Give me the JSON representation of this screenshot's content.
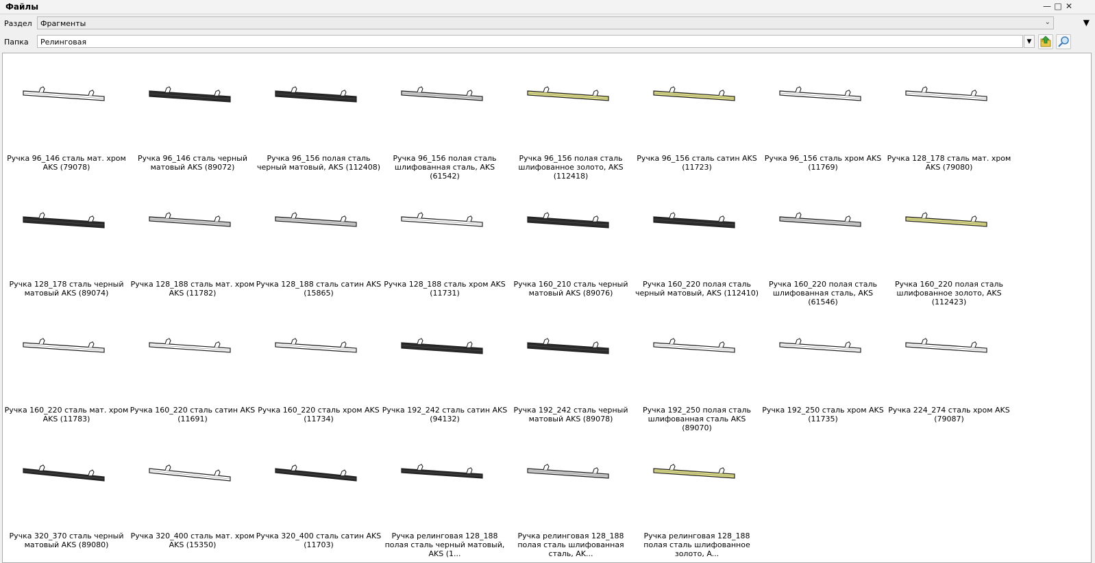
{
  "window": {
    "title": "Файлы",
    "minimize_icon": "minimize-icon",
    "maximize_icon": "maximize-icon",
    "close_icon": "close-icon"
  },
  "section": {
    "label": "Раздел",
    "value": "Фрагменты"
  },
  "folder": {
    "label": "Папка",
    "value": "Релинговая"
  },
  "colors": {
    "black": "#2b2b2b",
    "chrome": "#ffffff",
    "satin": "#d0d0d0",
    "gold": "#dddb82"
  },
  "items": [
    {
      "caption": "Ручка 96_146 сталь мат. хром AKS (79078)",
      "finish": "chrome"
    },
    {
      "caption": "Ручка 96_146 сталь черный матовый AKS (89072)",
      "finish": "black"
    },
    {
      "caption": "Ручка 96_156 полая сталь черный матовый, AKS (112408)",
      "finish": "black"
    },
    {
      "caption": "Ручка 96_156 полая сталь шлифованная сталь, AKS (61542)",
      "finish": "satin"
    },
    {
      "caption": "Ручка 96_156 полая сталь шлифованное золото, AKS (112418)",
      "finish": "gold"
    },
    {
      "caption": "Ручка 96_156 сталь сатин AKS (11723)",
      "finish": "gold"
    },
    {
      "caption": "Ручка 96_156 сталь хром AKS (11769)",
      "finish": "chrome"
    },
    {
      "caption": "Ручка 128_178 сталь мат. хром AKS (79080)",
      "finish": "chrome"
    },
    {
      "caption": "Ручка 128_178 сталь черный матовый AKS (89074)",
      "finish": "black"
    },
    {
      "caption": "Ручка 128_188 сталь мат. хром AKS (11782)",
      "finish": "satin"
    },
    {
      "caption": "Ручка 128_188 сталь сатин AKS (15865)",
      "finish": "satin"
    },
    {
      "caption": "Ручка 128_188 сталь хром AKS (11731)",
      "finish": "chrome"
    },
    {
      "caption": "Ручка 160_210 сталь черный матовый AKS (89076)",
      "finish": "black"
    },
    {
      "caption": "Ручка 160_220 полая сталь черный матовый, AKS (112410)",
      "finish": "black"
    },
    {
      "caption": "Ручка 160_220 полая сталь шлифованная сталь, AKS (61546)",
      "finish": "satin"
    },
    {
      "caption": "Ручка 160_220 полая сталь шлифованное золото, AKS (112423)",
      "finish": "gold"
    },
    {
      "caption": "Ручка 160_220 сталь мат. хром AKS (11783)",
      "finish": "chrome"
    },
    {
      "caption": "Ручка 160_220 сталь сатин AKS (11691)",
      "finish": "chrome"
    },
    {
      "caption": "Ручка 160_220 сталь хром AKS (11734)",
      "finish": "chrome"
    },
    {
      "caption": "Ручка 192_242 сталь сатин AKS (94132)",
      "finish": "black"
    },
    {
      "caption": "Ручка 192_242 сталь черный матовый AKS (89078)",
      "finish": "black"
    },
    {
      "caption": "Ручка 192_250 полая сталь шлифованная сталь AKS (89070)",
      "finish": "chrome"
    },
    {
      "caption": "Ручка 192_250 сталь хром AKS (11735)",
      "finish": "chrome"
    },
    {
      "caption": "Ручка 224_274 сталь хром AKS (79087)",
      "finish": "chrome"
    },
    {
      "caption": "Ручка 320_370 сталь черный матовый AKS (89080)",
      "finish": "black"
    },
    {
      "caption": "Ручка 320_400 сталь мат. хром AKS (15350)",
      "finish": "chrome"
    },
    {
      "caption": "Ручка 320_400 сталь сатин AKS (11703)",
      "finish": "black"
    },
    {
      "caption": "Ручка релинговая 128_188 полая сталь черный матовый, AKS (1...",
      "finish": "black"
    },
    {
      "caption": "Ручка релинговая 128_188 полая сталь шлифованная сталь, AK...",
      "finish": "satin"
    },
    {
      "caption": "Ручка релинговая 128_188 полая сталь шлифованное золото, A...",
      "finish": "gold"
    }
  ]
}
